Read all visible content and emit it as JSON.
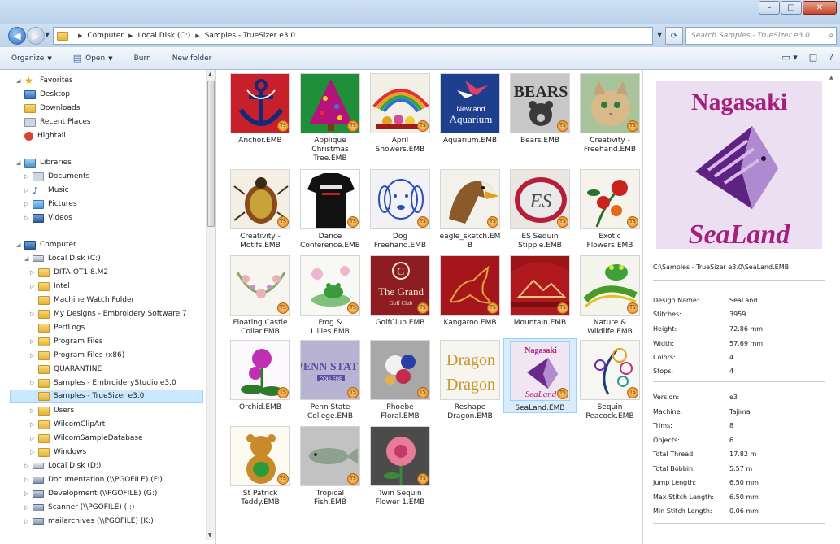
{
  "address": {
    "crumbs": [
      "Computer",
      "Local Disk (C:)",
      "Samples - TrueSizer e3.0"
    ],
    "search_placeholder": "Search Samples - TrueSizer e3.0"
  },
  "toolbar": {
    "organize": "Organize",
    "open": "Open",
    "burn": "Burn",
    "new_folder": "New folder"
  },
  "nav": {
    "favorites": "Favorites",
    "desktop": "Desktop",
    "downloads": "Downloads",
    "recent": "Recent Places",
    "hightail": "Hightail",
    "libraries": "Libraries",
    "documents": "Documents",
    "music": "Music",
    "pictures": "Pictures",
    "videos": "Videos",
    "computer": "Computer",
    "local_c": "Local Disk (C:)",
    "dita": "DITA-OT1.8.M2",
    "intel": "Intel",
    "mwf": "Machine Watch Folder",
    "mydesigns": "My Designs - Embroidery Software 7",
    "perflogs": "PerfLogs",
    "pf": "Program Files",
    "pf86": "Program Files (x86)",
    "quarantine": "QUARANTINE",
    "samples_es": "Samples - EmbroideryStudio e3.0",
    "samples_ts": "Samples - TrueSizer e3.0",
    "users": "Users",
    "wilcom_clip": "WilcomClipArt",
    "wilcom_db": "WilcomSampleDatabase",
    "windows": "Windows",
    "local_d": "Local Disk (D:)",
    "doc_f": "Documentation (\\\\PGOFILE) (F:)",
    "dev_g": "Development (\\\\PGOFILE) (G:)",
    "scan_i": "Scanner (\\\\PGOFILE) (I:)",
    "mail_k": "mailarchives (\\\\PGOFILE) (K:)"
  },
  "files": [
    {
      "l1": "Anchor.EMB",
      "l2": "",
      "l3": ""
    },
    {
      "l1": "Applique",
      "l2": "Christmas",
      "l3": "Tree.EMB"
    },
    {
      "l1": "April",
      "l2": "Showers.EMB",
      "l3": ""
    },
    {
      "l1": "Aquarium.EMB",
      "l2": "",
      "l3": ""
    },
    {
      "l1": "Bears.EMB",
      "l2": "",
      "l3": ""
    },
    {
      "l1": "Creativity -",
      "l2": "Freehand.EMB",
      "l3": ""
    },
    {
      "l1": "Creativity -",
      "l2": "Motifs.EMB",
      "l3": ""
    },
    {
      "l1": "Dance",
      "l2": "Conference.EMB",
      "l3": ""
    },
    {
      "l1": "Dog",
      "l2": "Freehand.EMB",
      "l3": ""
    },
    {
      "l1": "eagle_sketch.EM",
      "l2": "B",
      "l3": ""
    },
    {
      "l1": "ES Sequin",
      "l2": "Stipple.EMB",
      "l3": ""
    },
    {
      "l1": "Exotic",
      "l2": "Flowers.EMB",
      "l3": ""
    },
    {
      "l1": "Floating Castle",
      "l2": "Collar.EMB",
      "l3": ""
    },
    {
      "l1": "Frog &",
      "l2": "Lillies.EMB",
      "l3": ""
    },
    {
      "l1": "GolfClub.EMB",
      "l2": "",
      "l3": ""
    },
    {
      "l1": "Kangaroo.EMB",
      "l2": "",
      "l3": ""
    },
    {
      "l1": "Mountain.EMB",
      "l2": "",
      "l3": ""
    },
    {
      "l1": "Nature &",
      "l2": "Wildlife.EMB",
      "l3": ""
    },
    {
      "l1": "Orchid.EMB",
      "l2": "",
      "l3": ""
    },
    {
      "l1": "Penn State",
      "l2": "College.EMB",
      "l3": ""
    },
    {
      "l1": "Phoebe",
      "l2": "Floral.EMB",
      "l3": ""
    },
    {
      "l1": "Reshape",
      "l2": "Dragon.EMB",
      "l3": ""
    },
    {
      "l1": "SeaLand.EMB",
      "l2": "",
      "l3": ""
    },
    {
      "l1": "Sequin",
      "l2": "Peacock.EMB",
      "l3": ""
    },
    {
      "l1": "St Patrick",
      "l2": "Teddy.EMB",
      "l3": ""
    },
    {
      "l1": "Tropical",
      "l2": "Fish.EMB",
      "l3": ""
    },
    {
      "l1": "Twin Sequin",
      "l2": "Flower 1.EMB",
      "l3": ""
    }
  ],
  "thumb_text": {
    "aquarium_1": "Newland",
    "aquarium_2": "Aquarium",
    "bears": "BEARS",
    "golf_1": "The Grand",
    "golf_2": "Golf Club",
    "penn_1": "PENN STATE",
    "penn_2": "COLLEGE",
    "dragon": "Dragon",
    "sealand_top": "Nagasaki",
    "sealand_bottom": "SeaLand",
    "badge": "TS"
  },
  "preview": {
    "path": "C:\\Samples - TrueSizer e3.0\\SeaLand.EMB",
    "image_top": "Nagasaki",
    "image_bottom": "SeaLand",
    "props": [
      {
        "k": "Design Name:",
        "v": "SeaLand"
      },
      {
        "k": "Stitches:",
        "v": "3959"
      },
      {
        "k": "Height:",
        "v": "72.86 mm"
      },
      {
        "k": "Width:",
        "v": "57.69 mm"
      },
      {
        "k": "Colors:",
        "v": "4"
      },
      {
        "k": "Stops:",
        "v": "4"
      },
      {
        "k": "Version:",
        "v": "e3"
      },
      {
        "k": "Machine:",
        "v": "Tajima"
      },
      {
        "k": "Trims:",
        "v": "8"
      },
      {
        "k": "Objects:",
        "v": "6"
      },
      {
        "k": "Total Thread:",
        "v": "17.82 m"
      },
      {
        "k": "Total Bobbin:",
        "v": "5.57 m"
      },
      {
        "k": "Jump Length:",
        "v": "6.50 mm"
      },
      {
        "k": "Max Stitch Length:",
        "v": "6.50 mm"
      },
      {
        "k": "Min Stitch Length:",
        "v": "0.06 mm"
      }
    ]
  }
}
